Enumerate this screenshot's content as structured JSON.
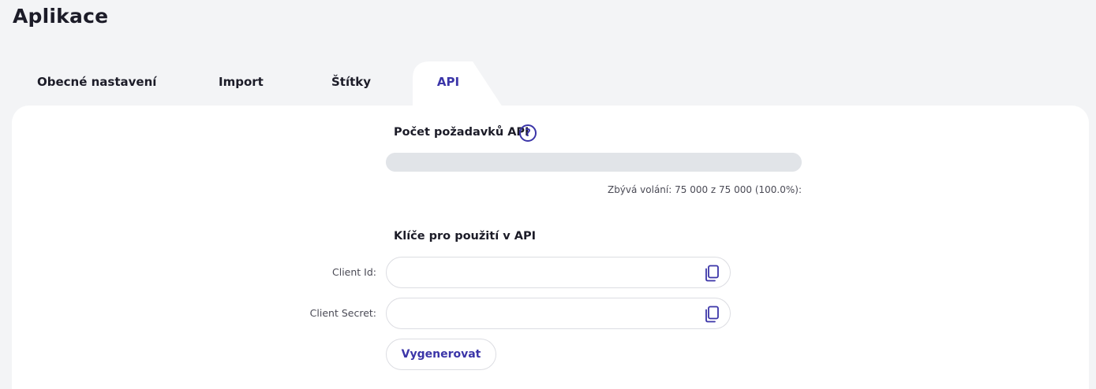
{
  "page": {
    "title": "Aplikace"
  },
  "tabs": [
    {
      "label": "Obecné nastavení",
      "active": false
    },
    {
      "label": "Import",
      "active": false
    },
    {
      "label": "Štítky",
      "active": false
    },
    {
      "label": "API",
      "active": true
    }
  ],
  "api_requests": {
    "title": "Počet požadavků API",
    "help_icon": "question-circle-icon",
    "remaining_fraction": 1.0,
    "remaining_text": "Zbývá volání: 75 000 z 75 000 (100.0%):"
  },
  "api_keys": {
    "title": "Klíče pro použití v API",
    "client_id": {
      "label": "Client Id:",
      "value": ""
    },
    "client_secret": {
      "label": "Client Secret:",
      "value": ""
    },
    "copy_icon": "copy-icon",
    "generate_label": "Vygenerovat"
  },
  "colors": {
    "accent": "#3b35a8",
    "background": "#f3f4f6",
    "panel": "#ffffff",
    "track": "#e1e4e8"
  }
}
